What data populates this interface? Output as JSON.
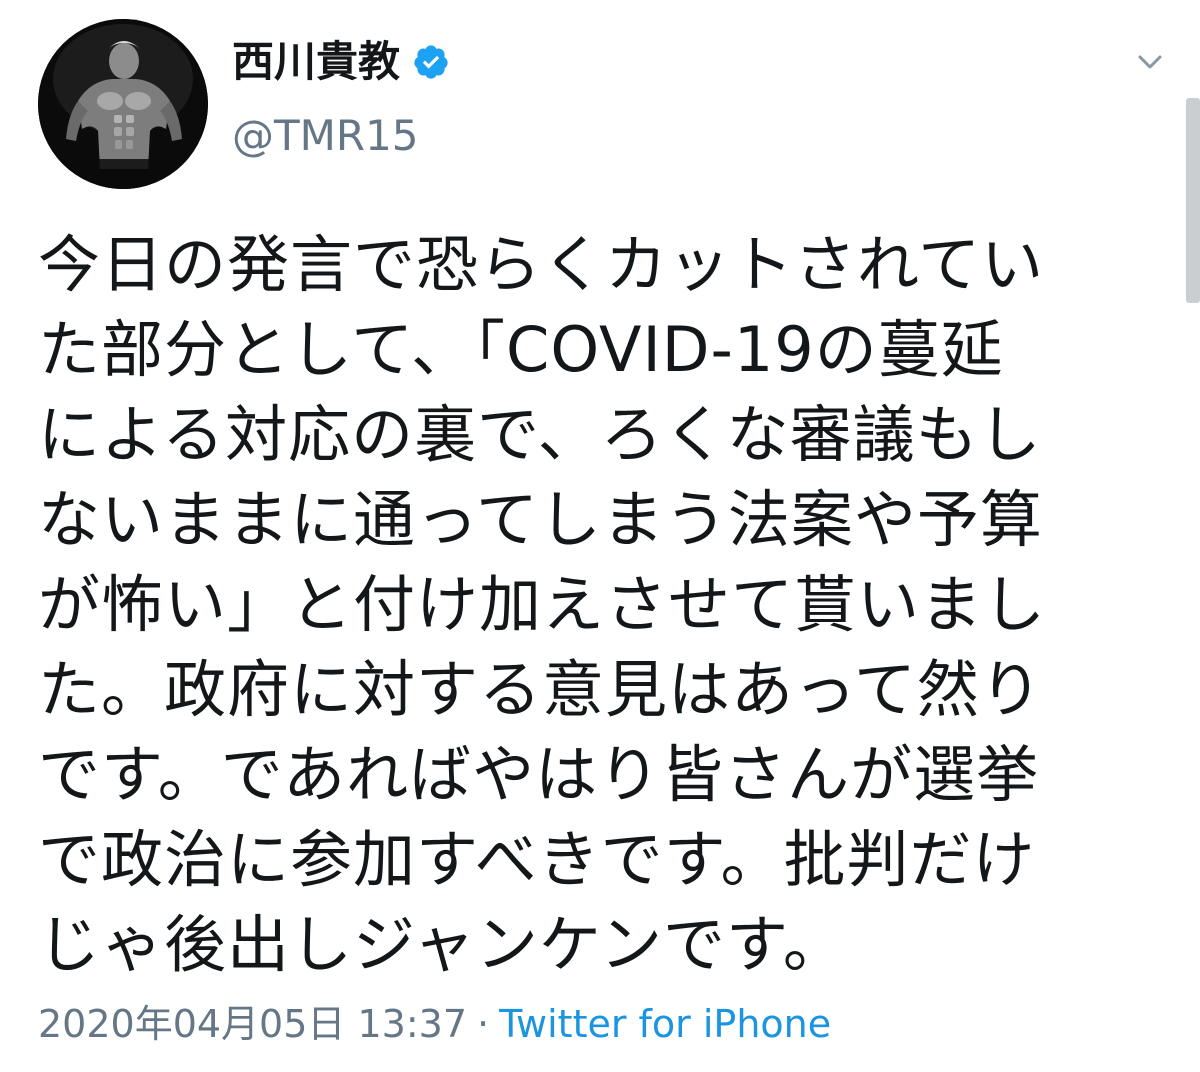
{
  "user": {
    "display_name": "西川貴教",
    "handle": "@TMR15",
    "verified": true
  },
  "tweet": {
    "lines": [
      "今日の発言で恐らくカットされてい",
      "た部分として、「COVID-19の蔓延",
      "による対応の裏で、ろくな審議もし",
      "ないままに通ってしまう法案や予算",
      "が怖い」と付け加えさせて貰いまし",
      "た。政府に対する意見はあって然り",
      "です。であればやはり皆さんが選挙",
      "で政治に参加すべきです。批判だけ",
      "じゃ後出しジャンケンです。"
    ]
  },
  "meta": {
    "timestamp": "2020年04月05日 13:37",
    "separator": "·",
    "source": "Twitter for iPhone"
  },
  "icons": {
    "verified": "verified-badge-icon",
    "menu": "chevron-down-icon"
  },
  "colors": {
    "text": "#14171a",
    "secondary": "#657786",
    "link": "#1b95e0",
    "verified": "#1da1f2"
  }
}
